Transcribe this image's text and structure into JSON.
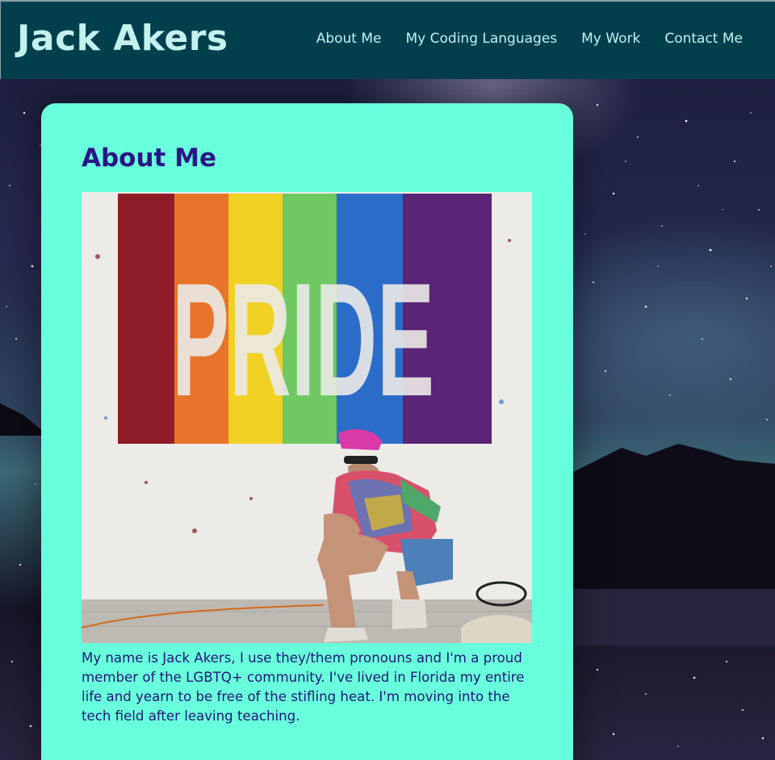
{
  "site": {
    "title": "Jack Akers"
  },
  "nav": {
    "items": [
      {
        "label": "About Me"
      },
      {
        "label": "My Coding Languages"
      },
      {
        "label": "My Work"
      },
      {
        "label": "Contact Me"
      }
    ]
  },
  "about": {
    "heading": "About Me",
    "photo_sign_text": "PRIDE",
    "bio": "My name is Jack Akers, I use they/them pronouns and I'm a proud member of the LGBTQ+ community. I've lived in Florida my entire life and yearn to be free of the stifling heat. I'm moving into the tech field after leaving teaching."
  },
  "colors": {
    "header_bg": "#013f4d",
    "header_text": "#c3f2ee",
    "card_bg": "#68ffdc",
    "heading": "#2a1785",
    "body_text": "#241577"
  }
}
